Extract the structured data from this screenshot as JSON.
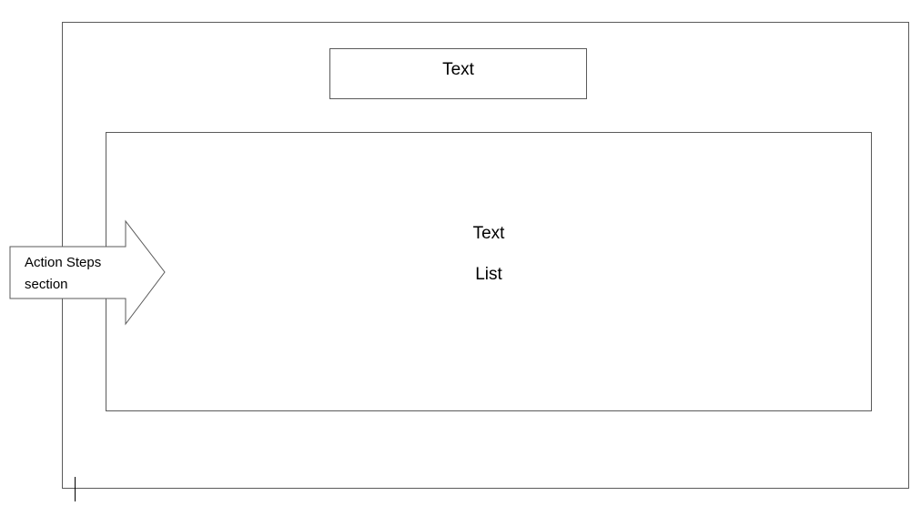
{
  "header_box": {
    "label": "Text"
  },
  "content_box": {
    "line1": "Text",
    "line2": "List"
  },
  "callout": {
    "line1": "Action Steps",
    "line2": "section"
  },
  "colors": {
    "border": "#5a5a5a",
    "background": "#ffffff",
    "text": "#000000"
  }
}
